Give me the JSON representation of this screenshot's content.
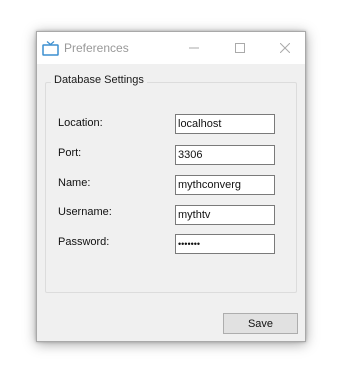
{
  "window": {
    "title": "Preferences",
    "app_icon": "tv-icon",
    "controls": {
      "minimize": "minimize-icon",
      "maximize": "maximize-icon",
      "close": "close-icon"
    }
  },
  "group": {
    "title": "Database Settings"
  },
  "fields": [
    {
      "label": "Location:",
      "value": "localhost"
    },
    {
      "label": "Port:",
      "value": "3306"
    },
    {
      "label": "Name:",
      "value": "mythconverg"
    },
    {
      "label": "Username:",
      "value": "mythtv"
    },
    {
      "label": "Password:",
      "value": "•••••••"
    }
  ],
  "buttons": {
    "save_label": "Save"
  },
  "colors": {
    "window_bg": "#f0f0f0",
    "titlebar_bg": "#ffffff",
    "title_text": "#999999",
    "icon_accent": "#3c8fd0",
    "input_border": "#7a7a7a",
    "button_bg": "#e1e1e1"
  }
}
